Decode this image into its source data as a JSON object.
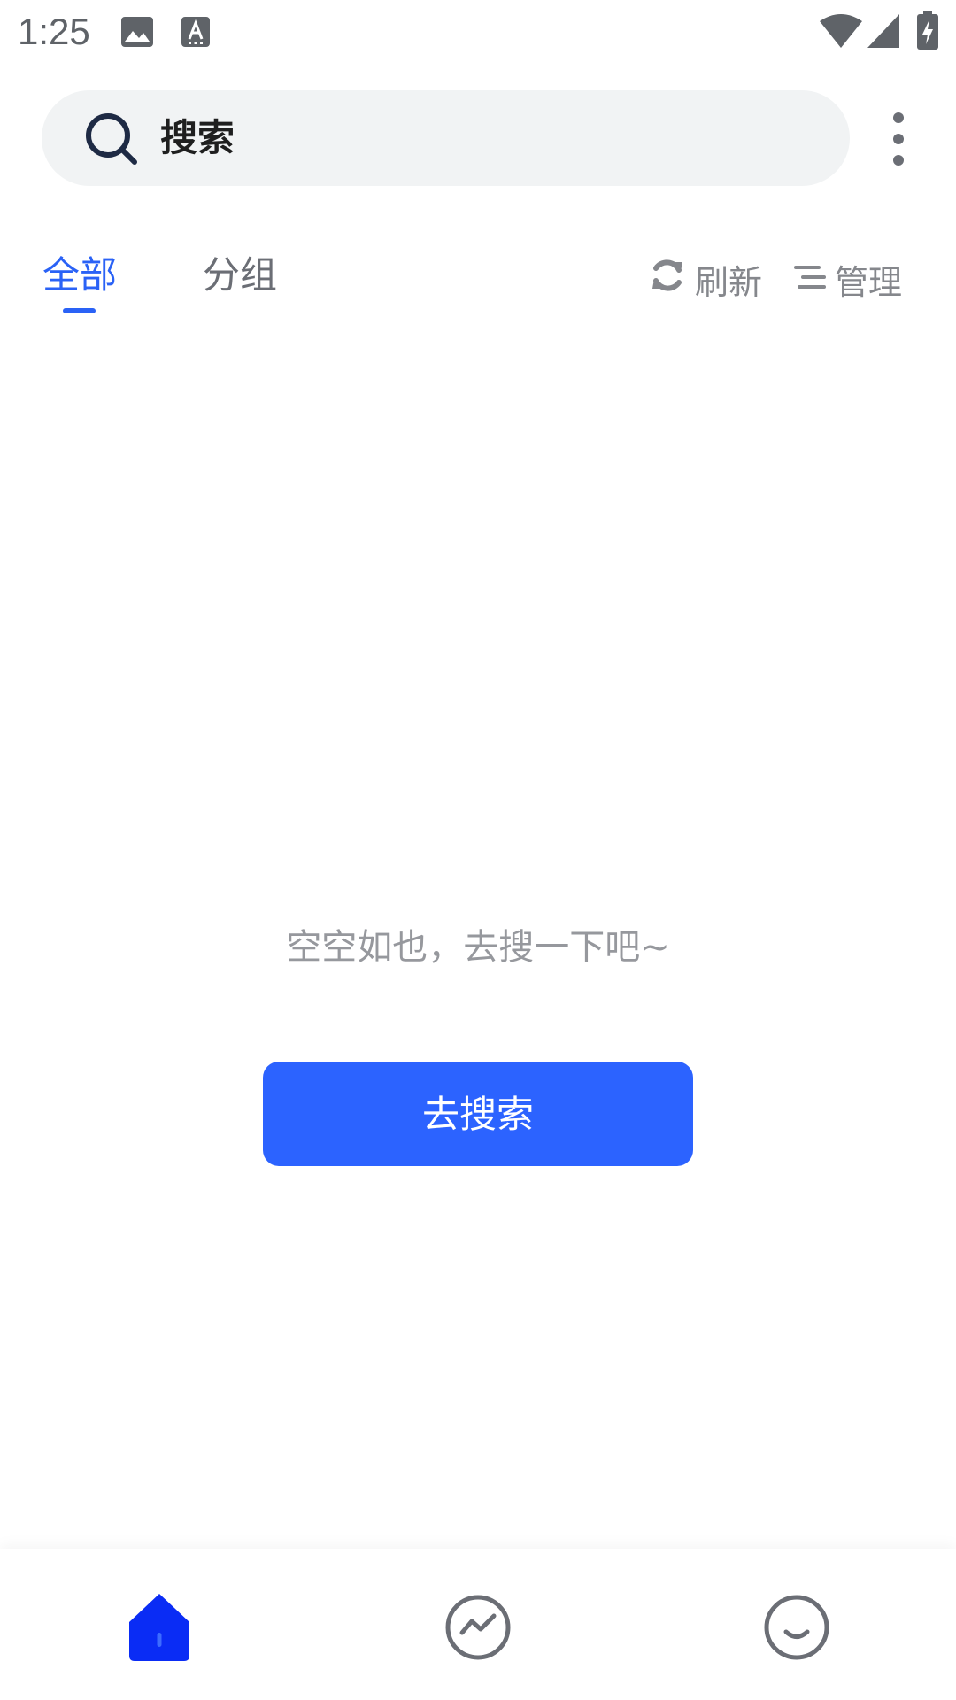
{
  "status_bar": {
    "time": "1:25",
    "icons": [
      "image-notification-icon",
      "keyboard-notification-icon",
      "wifi-icon",
      "signal-icon",
      "battery-charging-icon"
    ]
  },
  "search": {
    "placeholder": "搜索"
  },
  "tabs": [
    {
      "label": "全部",
      "active": true
    },
    {
      "label": "分组",
      "active": false
    }
  ],
  "toolbar": {
    "refresh_label": "刷新",
    "manage_label": "管理"
  },
  "empty_state": {
    "message": "空空如也，去搜一下吧~",
    "button_label": "去搜索"
  },
  "bottom_nav": {
    "items": [
      {
        "icon": "home-icon",
        "active": true
      },
      {
        "icon": "trend-icon",
        "active": false
      },
      {
        "icon": "smile-icon",
        "active": false
      }
    ]
  },
  "colors": {
    "accent": "#2a62f6",
    "button": "#2c63ff",
    "nav_active": "#0a2cf5",
    "muted_text": "#96989d"
  }
}
